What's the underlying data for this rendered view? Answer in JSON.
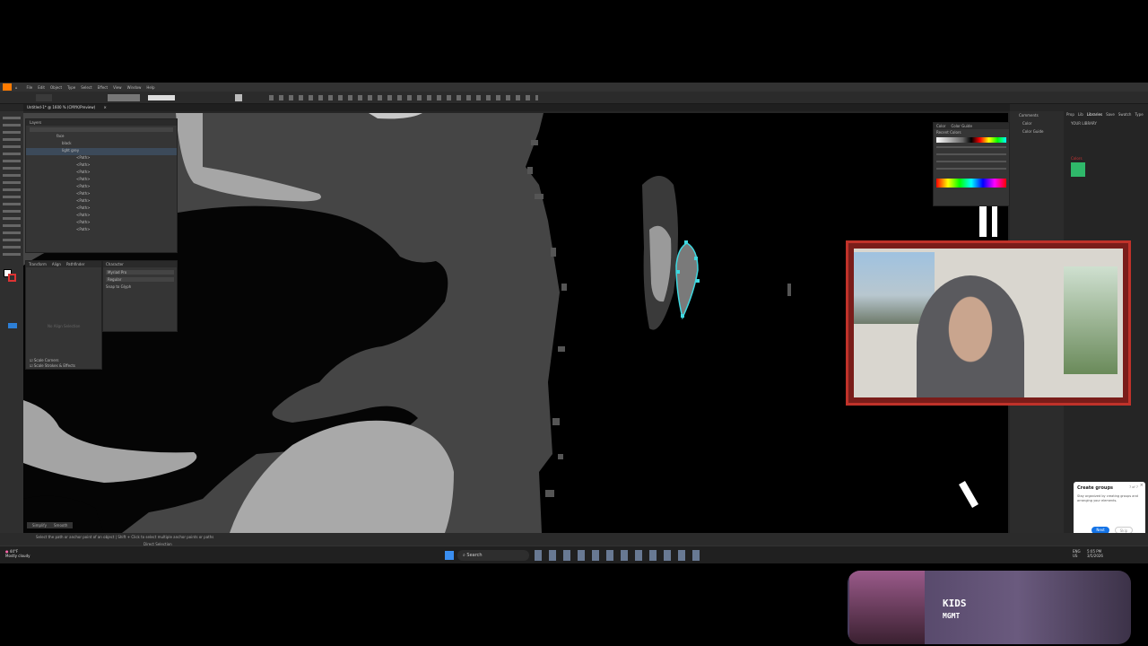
{
  "menu": [
    "File",
    "Edit",
    "Object",
    "Type",
    "Select",
    "Effect",
    "View",
    "Window",
    "Help"
  ],
  "document_tab": "Untitled-1* @ 1600 % (CMYK/Preview)",
  "layers_panel": {
    "tab": "Layers",
    "rows": [
      "face",
      "black",
      "light grey",
      "<Path>",
      "<Path>",
      "<Path>",
      "<Path>",
      "<Path>",
      "<Path>",
      "<Path>",
      "<Path>",
      "<Path>",
      "<Path>",
      "<Path>"
    ]
  },
  "properties_panel": {
    "tabs": [
      "Transform",
      "Align",
      "Pathfinder"
    ],
    "character_tab": "Character",
    "font": "Myriad Pro",
    "style": "Regular",
    "snap": "Snap to Glyph",
    "no_align": "No Align Selection"
  },
  "scale_options": [
    "Scale Corners",
    "Scale Strokes & Effects"
  ],
  "color_panel": {
    "tabs": [
      "Color",
      "Color Guide"
    ],
    "recent": "Recent Colors"
  },
  "right_tabs": [
    "Comments",
    "Color",
    "Color Guide"
  ],
  "libraries": {
    "tabs": [
      "Prop",
      "Lib",
      "Libraries",
      "Save",
      "Swatch",
      "Type"
    ],
    "heading": "YOUR LIBRARY",
    "colors_label": "Colors",
    "swatch_color": "#2fb86a"
  },
  "tip": {
    "title": "Create groups",
    "count": "7 of 7",
    "body": "Stay organized by creating groups and arranging your elements.",
    "next": "Next",
    "skip": "Skip"
  },
  "status": {
    "left": "Select the path or anchor point of an object  |  Shift + Click to select multiple anchor points or paths",
    "tools": [
      "Simplify",
      "Smooth"
    ],
    "center": "Direct Selection"
  },
  "taskbar": {
    "weather_temp": "44°F",
    "weather_desc": "Mostly cloudy",
    "search": "Search",
    "lang": "ENG",
    "region": "US",
    "time": "5:05 PM",
    "date": "3/5/2026"
  },
  "music": {
    "title": "KIDS",
    "artist": "MGMT"
  }
}
